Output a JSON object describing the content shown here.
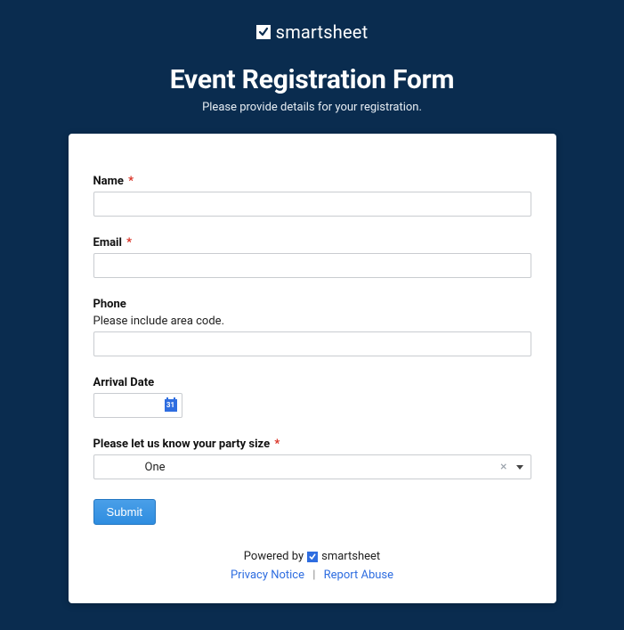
{
  "brand": {
    "name": "smartsheet"
  },
  "header": {
    "title": "Event Registration Form",
    "subtitle": "Please provide details for your registration."
  },
  "fields": {
    "name": {
      "label": "Name",
      "required_marker": "*",
      "value": ""
    },
    "email": {
      "label": "Email",
      "required_marker": "*",
      "value": ""
    },
    "phone": {
      "label": "Phone",
      "help": "Please include area code.",
      "value": ""
    },
    "arrival": {
      "label": "Arrival Date",
      "value": "",
      "icon_text": "31"
    },
    "party": {
      "label": "Please let us know your party size",
      "required_marker": "*",
      "value": "One",
      "clear_symbol": "×"
    }
  },
  "actions": {
    "submit": "Submit"
  },
  "footer": {
    "powered_by": "Powered by",
    "brand": "smartsheet",
    "privacy": "Privacy Notice",
    "separator": "|",
    "report": "Report Abuse"
  }
}
